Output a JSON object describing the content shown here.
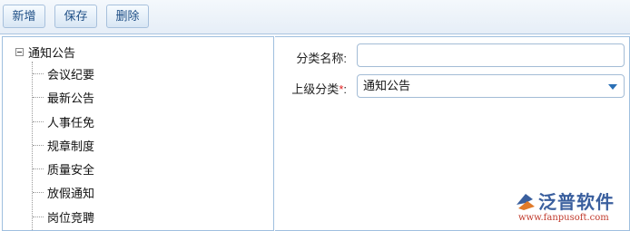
{
  "toolbar": {
    "add_label": "新增",
    "save_label": "保存",
    "delete_label": "删除"
  },
  "tree": {
    "root_label": "通知公告",
    "items": [
      {
        "label": "会议纪要"
      },
      {
        "label": "最新公告"
      },
      {
        "label": "人事任免"
      },
      {
        "label": "规章制度"
      },
      {
        "label": "质量安全"
      },
      {
        "label": "放假通知"
      },
      {
        "label": "岗位竞聘"
      }
    ]
  },
  "form": {
    "category_name_label": "分类名称:",
    "category_name_value": "",
    "parent_category_label": "上级分类",
    "required_mark": "*",
    "parent_category_colon": ":",
    "parent_category_value": "通知公告"
  },
  "logo": {
    "name": "泛普软件",
    "url": "www.fanpusoft.com"
  },
  "colors": {
    "accent": "#2a6fb5",
    "border": "#9fbfdf",
    "required": "#e02020"
  }
}
